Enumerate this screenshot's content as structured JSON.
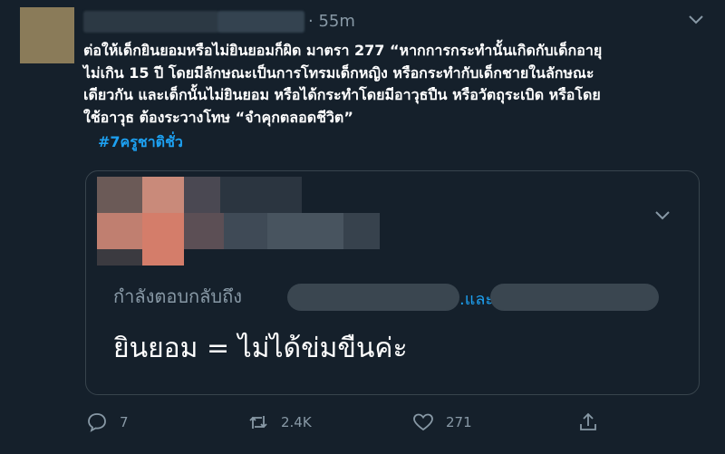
{
  "tweet": {
    "time": "· 55m",
    "lines": [
      "ต่อให้เด็กยินยอมหรือไม่ยินยอมก็ผิด มาตรา 277 “หากการกระทำนั้นเกิดกับเด็กอายุ",
      "ไม่เกิน 15 ปี โดยมีลักษณะเป็นการโทรมเด็กหญิง หรือกระทำกับเด็กชายในลักษณะ",
      "เดียวกัน และเด็กนั้นไม่ยินยอม หรือได้กระทำโดยมีอาวุธปืน หรือวัตถุระเบิด หรือโดย",
      "ใช้อาวุธ ต้องระวางโทษ “จำคุกตลอดชีวิต”"
    ],
    "hashtag": "#7ครูชาติชั่ว"
  },
  "quote": {
    "reply_prefix": "กำลังตอบกลับถึง",
    "and": ".และ",
    "text": "ยินยอม = ไม่ได้ข่มขืนค่ะ"
  },
  "actions": {
    "reply_count": "7",
    "retweet_count": "2.4K",
    "like_count": "271"
  },
  "colors": {
    "background": "#15202b",
    "secondary_text": "#8899a6",
    "link": "#1da1f2",
    "border": "#38444d"
  }
}
